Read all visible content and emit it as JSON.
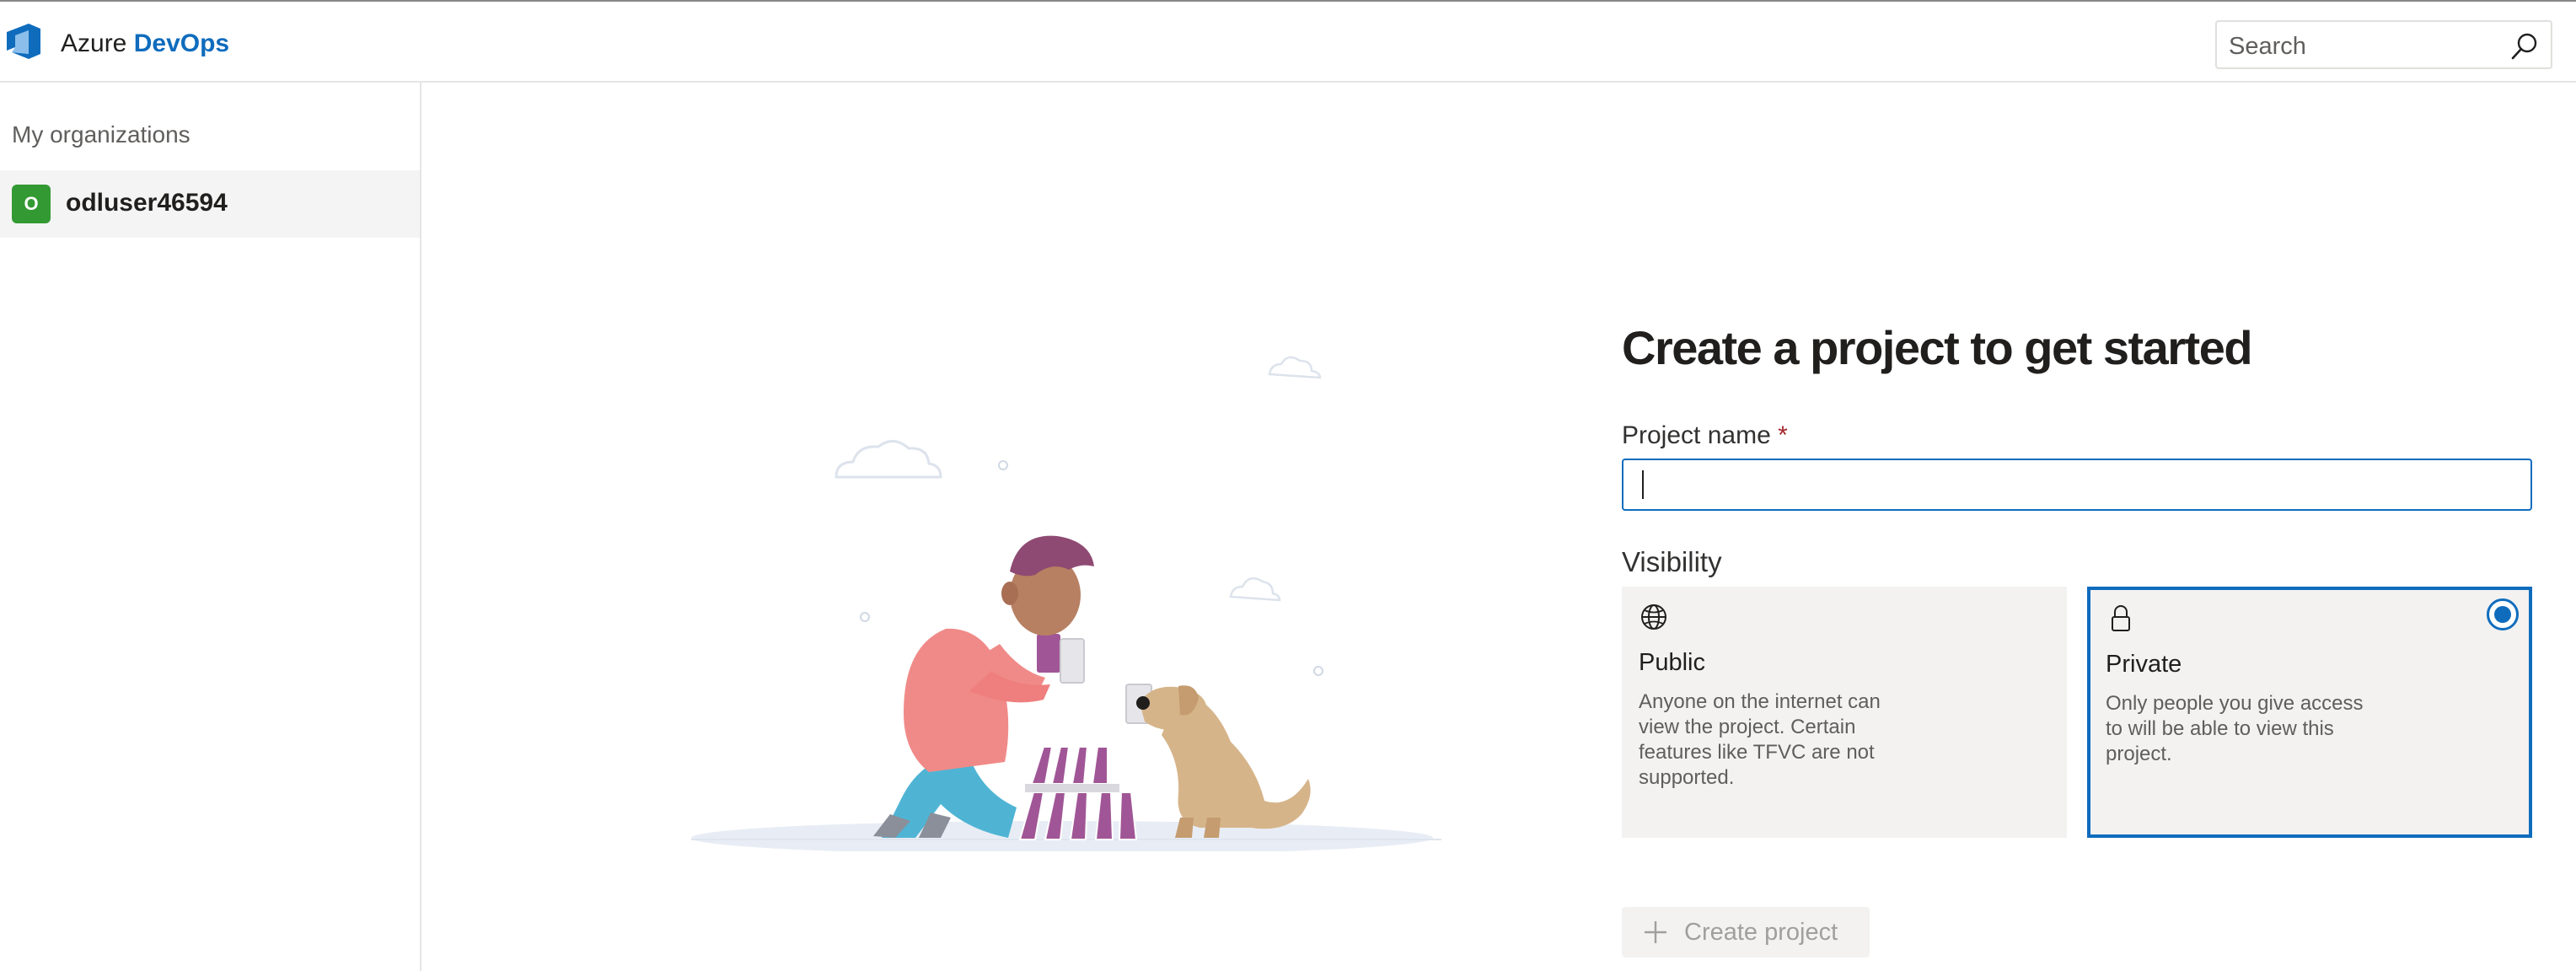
{
  "header": {
    "brand_prefix": "Azure",
    "brand_accent": "DevOps",
    "search_placeholder": "Search"
  },
  "sidebar": {
    "heading": "My organizations",
    "organizations": [
      {
        "initial": "O",
        "name": "odluser46594",
        "color": "#339933"
      }
    ]
  },
  "main": {
    "title": "Create a project to get started",
    "project_name_label": "Project name",
    "required_marker": "*",
    "project_name_value": "",
    "visibility_label": "Visibility",
    "visibility_options": [
      {
        "icon": "globe-icon",
        "title": "Public",
        "description": "Anyone on the internet can view the project. Certain features like TFVC are not supported.",
        "selected": false
      },
      {
        "icon": "lock-icon",
        "title": "Private",
        "description": "Only people you give access to will be able to view this project.",
        "selected": true
      }
    ],
    "create_button_label": "Create project",
    "create_button_enabled": false
  },
  "colors": {
    "accent": "#0f6cbd",
    "org_avatar": "#339933",
    "required": "#a4262c"
  }
}
